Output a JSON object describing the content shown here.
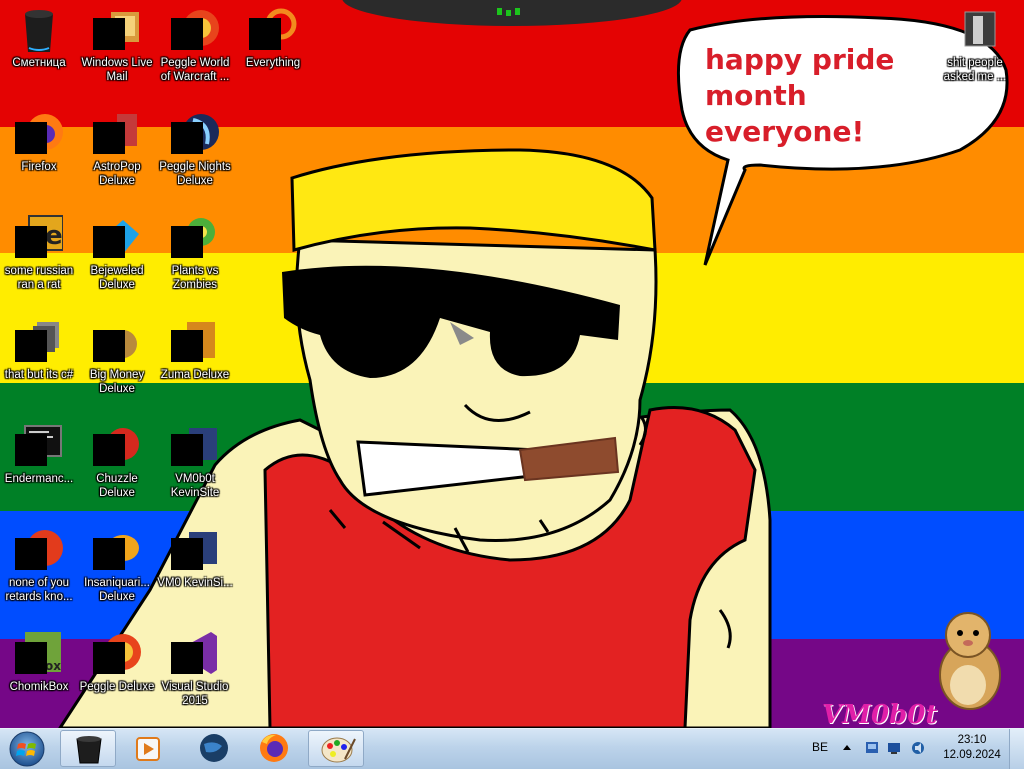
{
  "desktop": {
    "rainbow_colors": [
      "#e40303",
      "#ff8c00",
      "#ffed00",
      "#008026",
      "#004dff",
      "#750787"
    ],
    "speech_bubble": {
      "line1": "happy pride month",
      "line2": "everyone!"
    },
    "watermark": "VM0b0t",
    "icons": [
      {
        "label": "Сметница",
        "icon": "recycle-bin-icon",
        "censored": false
      },
      {
        "label": "Windows Live Mail",
        "icon": "mail-icon",
        "censored": true
      },
      {
        "label": "Peggle World of Warcraft ...",
        "icon": "peggle-icon",
        "censored": true
      },
      {
        "label": "Everything",
        "icon": "search-app-icon",
        "censored": true
      },
      {
        "label": "Firefox",
        "icon": "firefox-icon",
        "censored": true
      },
      {
        "label": "AstroPop Deluxe",
        "icon": "game-icon",
        "censored": true
      },
      {
        "label": "Peggle Nights Deluxe",
        "icon": "peggle-nights-icon",
        "censored": true
      },
      {
        "label": "some russian ran a rat",
        "icon": "rat-app-icon",
        "censored": true
      },
      {
        "label": "Bejeweled Deluxe",
        "icon": "gem-icon",
        "censored": true
      },
      {
        "label": "Plants vs Zombies",
        "icon": "plant-icon",
        "censored": true
      },
      {
        "label": "that but its c#",
        "icon": "document-stack-icon",
        "censored": true
      },
      {
        "label": "Big Money Deluxe",
        "icon": "money-bag-icon",
        "censored": true
      },
      {
        "label": "Zuma Deluxe",
        "icon": "zuma-icon",
        "censored": true
      },
      {
        "label": "Endermanc...",
        "icon": "terminal-icon",
        "censored": true
      },
      {
        "label": "Chuzzle Deluxe",
        "icon": "chuzzle-icon",
        "censored": true
      },
      {
        "label": "VM0b0t KevinSite",
        "icon": "shortcut-icon",
        "censored": true
      },
      {
        "label": "none of you retards kno...",
        "icon": "app-icon",
        "censored": true
      },
      {
        "label": "Insaniquari... Deluxe",
        "icon": "fish-icon",
        "censored": true
      },
      {
        "label": "VM0 KevinSi...",
        "icon": "shortcut-icon",
        "censored": true
      },
      {
        "label": "ChomikBox",
        "icon": "hamster-icon",
        "censored": true
      },
      {
        "label": "Peggle Deluxe",
        "icon": "peggle-icon",
        "censored": true
      },
      {
        "label": "Visual Studio 2015",
        "icon": "visual-studio-icon",
        "censored": true
      },
      {
        "label": "shit people asked me ...",
        "icon": "folder-icon",
        "censored": false
      }
    ]
  },
  "taskbar": {
    "pinned": [
      {
        "name": "recycle-bin-icon",
        "active": true
      },
      {
        "name": "media-player-icon",
        "active": false
      },
      {
        "name": "globe-icon",
        "active": false
      },
      {
        "name": "firefox-icon",
        "active": false
      },
      {
        "name": "paint-icon",
        "active": true
      }
    ],
    "tray": {
      "language": "BE",
      "time": "23:10",
      "date": "12.09.2024"
    }
  }
}
